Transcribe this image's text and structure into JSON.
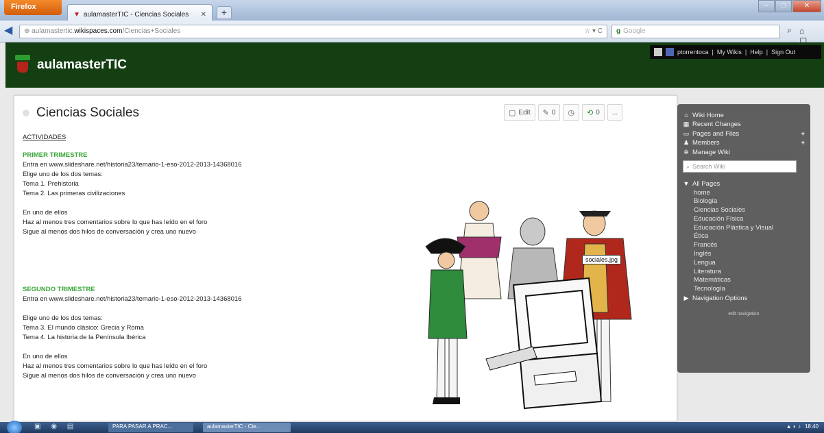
{
  "browser": {
    "app_button": "Firefox",
    "tab_title": "aulamasterTIC - Ciencias Sociales",
    "url_prefix": "aulamastertic.",
    "url_domain": "wikispaces.com",
    "url_path": "/Ciencias+Sociales",
    "search_placeholder": "Google"
  },
  "site": {
    "title": "aulamasterTIC",
    "user_links": [
      "ptorrentoca",
      "My Wikis",
      "Help",
      "Sign Out"
    ]
  },
  "page": {
    "title": "Ciencias Sociales",
    "toolbar": {
      "edit_label": "Edit",
      "comments_count": "0",
      "follow_count": "0",
      "more_label": "..."
    },
    "activities_label": "ACTIVIDADES",
    "trimester1": {
      "heading": "PRIMER TRIMESTRE",
      "line1": "Entra en www.slideshare.net/historia23/temario-1-eso-2012-2013-14368016",
      "line2": "Elige uno de los dos temas:",
      "line3": "Tema 1. Prehistoria",
      "line4": "Tema 2. Las primeras civilizaciones",
      "line5": "En uno de ellos",
      "line6": "Haz al menos tres comentarios sobre lo que has leído en el foro",
      "line7": "Sigue al menos dos hilos de conversación y crea uno nuevo"
    },
    "trimester2": {
      "heading": "SEGUNDO TRIMESTRE",
      "line1": "Entra en www.slideshare.net/historia23/temario-1-eso-2012-2013-14368016",
      "line2": "Elige uno de los dos temas:",
      "line3": "Tema 3. El mundo clásico: Grecia y Roma",
      "line4": "Tema 4. La historia de la Península Ibérica",
      "line5": "En uno de ellos",
      "line6": "Haz al menos tres comentarios sobre lo que has leído en el foro",
      "line7": "Sigue al menos dos hilos de conversación y crea uno nuevo"
    },
    "image_label": "sociales.jpg"
  },
  "sidebar": {
    "wiki_home": "Wiki Home",
    "recent_changes": "Recent Changes",
    "pages_and_files": "Pages and Files",
    "members": "Members",
    "manage_wiki": "Manage Wiki",
    "search_placeholder": "Search Wiki",
    "all_pages": "All Pages",
    "pages": [
      "home",
      "Biología",
      "Ciencias Sociales",
      "Educación Física",
      "Educación Plástica y Visual",
      "Ética",
      "Francés",
      "Inglés",
      "Lengua",
      "Literatura",
      "Matemáticas",
      "Tecnología"
    ],
    "navigation_options": "Navigation Options",
    "edit_navigation": "edit navigation"
  },
  "taskbar": {
    "app1": "PARA PASAR A PRAC...",
    "app2": "aulamasterTIC - Cie...",
    "clock": "18:40"
  }
}
